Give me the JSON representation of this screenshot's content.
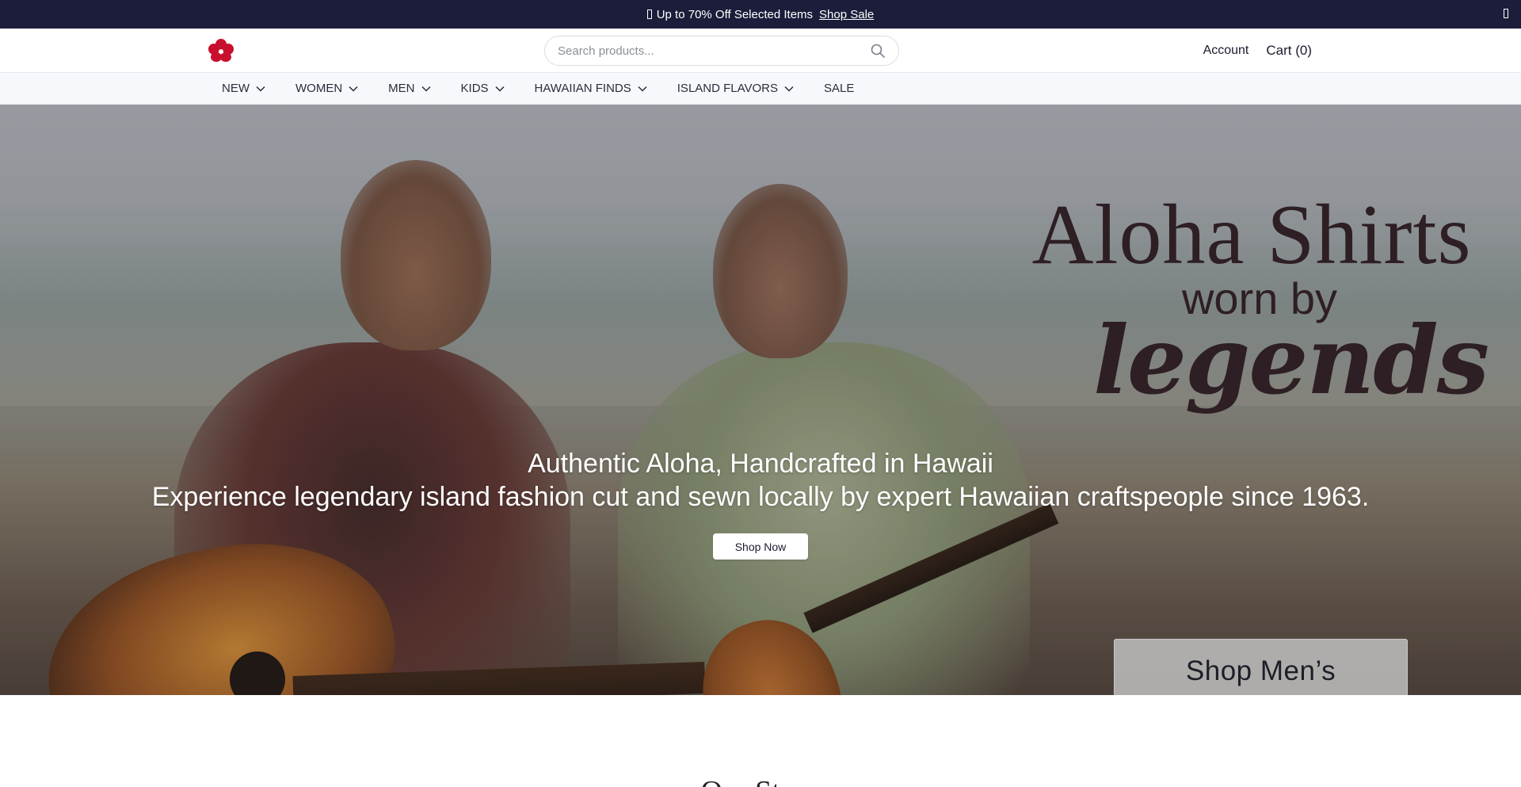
{
  "announcement": {
    "text": "Up to 70% Off Selected Items",
    "link": "Shop Sale"
  },
  "header": {
    "logo_alt": "logo",
    "search_placeholder": "Search products...",
    "account_label": "Account",
    "cart_label": "Cart (0)"
  },
  "nav": {
    "items": [
      {
        "label": "NEW",
        "has_dropdown": true
      },
      {
        "label": "WOMEN",
        "has_dropdown": true
      },
      {
        "label": "MEN",
        "has_dropdown": true
      },
      {
        "label": "KIDS",
        "has_dropdown": true
      },
      {
        "label": "HAWAIIAN FINDS",
        "has_dropdown": true
      },
      {
        "label": "ISLAND FLAVORS",
        "has_dropdown": true
      },
      {
        "label": "SALE",
        "has_dropdown": false
      }
    ]
  },
  "hero": {
    "logo_line1": "Aloha Shirts",
    "logo_line2": "worn by",
    "logo_line3": "legends",
    "headline": "Authentic Aloha, Handcrafted in Hawaii",
    "subheadline": "Experience legendary island fashion cut and sewn locally by expert Hawaiian craftspeople since 1963.",
    "cta_label": "Shop Now",
    "secondary_cta_label": "Shop Men’s"
  },
  "story": {
    "title": "Our Story"
  },
  "colors": {
    "announcement_bg": "#1c1d3a",
    "logo_red": "#c8102e",
    "nav_bg": "#f6f8fb"
  },
  "icons": {
    "search": "search-icon",
    "chevron": "chevron-down-icon",
    "close": "close-icon",
    "tag": "tag-icon"
  }
}
